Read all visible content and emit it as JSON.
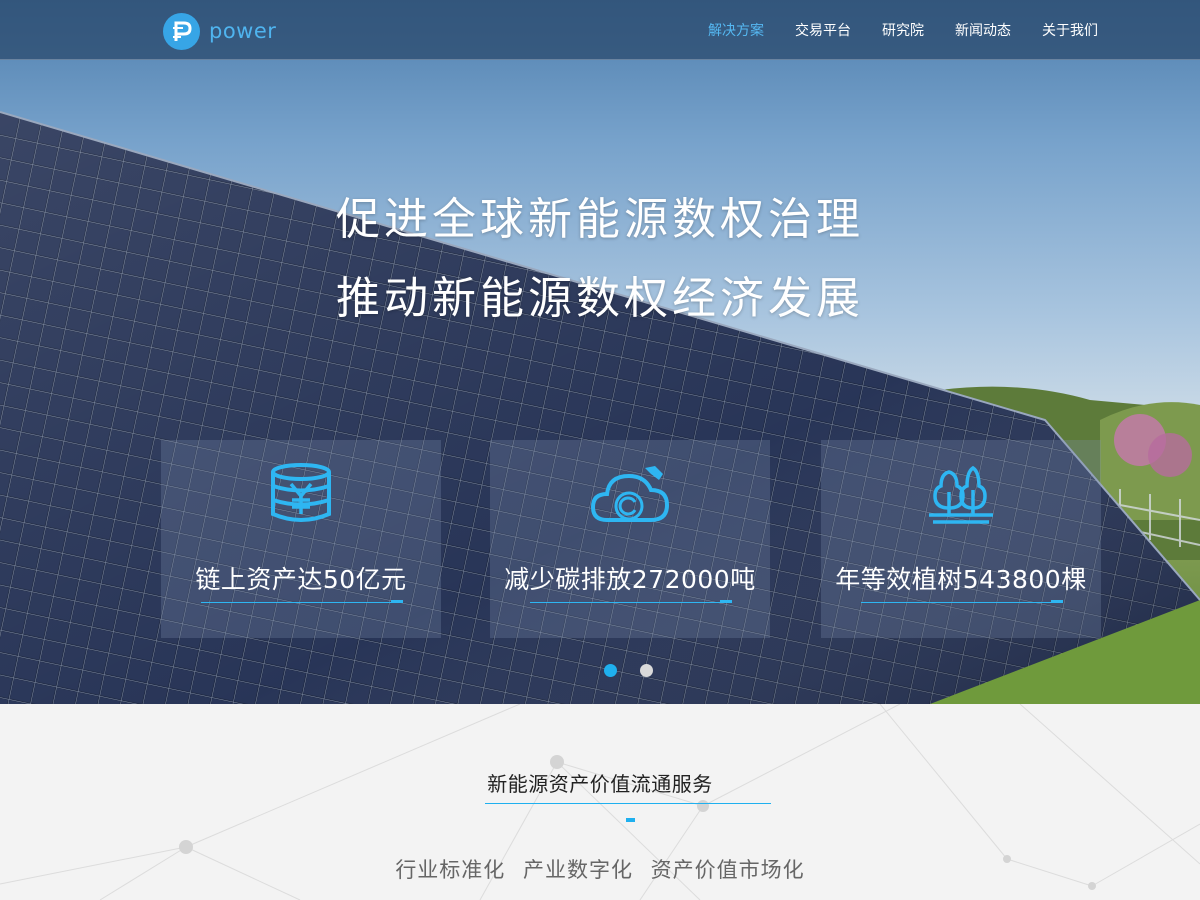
{
  "header": {
    "logo_text": "power",
    "nav": [
      {
        "label": "解决方案",
        "active": true
      },
      {
        "label": "交易平台",
        "active": false
      },
      {
        "label": "研究院",
        "active": false
      },
      {
        "label": "新闻动态",
        "active": false
      },
      {
        "label": "关于我们",
        "active": false
      }
    ]
  },
  "hero": {
    "headline_1": "促进全球新能源数权治理",
    "headline_2": "推动新能源数权经济发展",
    "stats": [
      {
        "icon": "coins-yen-icon",
        "text": "链上资产达50亿元"
      },
      {
        "icon": "cloud-carbon-icon",
        "text": "减少碳排放272000吨"
      },
      {
        "icon": "trees-icon",
        "text": "年等效植树543800棵"
      }
    ],
    "carousel": {
      "slide_count": 2,
      "active_index": 0
    }
  },
  "services": {
    "title": "新能源资产价值流通服务",
    "subtitle": "行业标准化 产业数字化 资产价值市场化"
  },
  "colors": {
    "accent": "#1fb0ef",
    "nav_active": "#55b8f2",
    "logo": "#37a5e6"
  }
}
